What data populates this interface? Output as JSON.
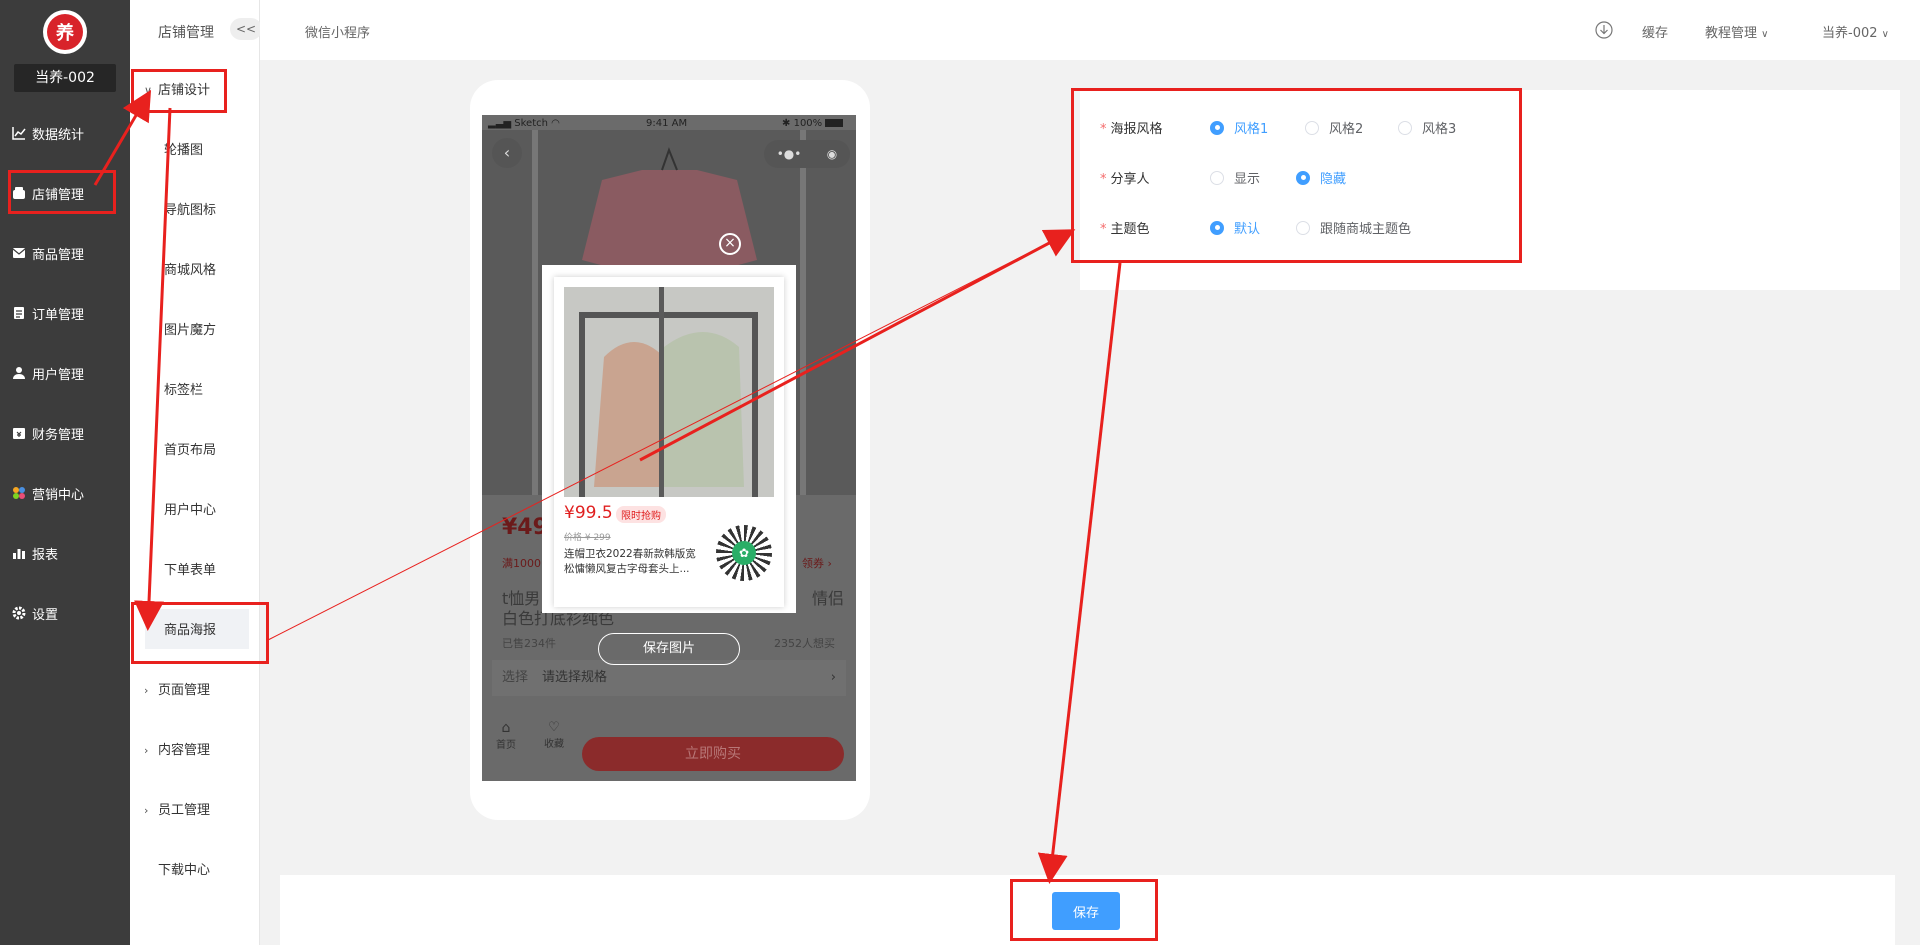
{
  "sidebar": {
    "store_name": "当养-002",
    "items": [
      {
        "label": "数据统计",
        "icon": "chart-line-icon"
      },
      {
        "label": "店铺管理",
        "icon": "store-icon"
      },
      {
        "label": "商品管理",
        "icon": "envelope-icon"
      },
      {
        "label": "订单管理",
        "icon": "clipboard-icon"
      },
      {
        "label": "用户管理",
        "icon": "user-icon"
      },
      {
        "label": "财务管理",
        "icon": "finance-icon"
      },
      {
        "label": "营销中心",
        "icon": "marketing-icon"
      },
      {
        "label": "报表",
        "icon": "bar-chart-icon"
      },
      {
        "label": "设置",
        "icon": "gear-icon"
      }
    ]
  },
  "submenu": {
    "title": "店铺管理",
    "collapse_label": "<<",
    "group_design": "店铺设计",
    "items": [
      "轮播图",
      "导航图标",
      "商城风格",
      "图片魔方",
      "标签栏",
      "首页布局",
      "用户中心",
      "下单表单",
      "商品海报"
    ],
    "group_page": "页面管理",
    "group_content": "内容管理",
    "group_staff": "员工管理",
    "download": "下载中心"
  },
  "topbar": {
    "breadcrumb": "微信小程序",
    "cache": "缓存",
    "tutorial": "教程管理",
    "user": "当养-002"
  },
  "phone": {
    "carrier": "Sketch",
    "time": "9:41 AM",
    "battery": "100%",
    "price_partial": "¥49",
    "coupon_partial": "满1000",
    "get_coupon": "领券",
    "title_left": "t恤男",
    "title_right": "情侣",
    "title_line2": "白色打底衫纯色",
    "sold": "已售234件",
    "wants": "2352人想买",
    "select_label": "选择",
    "select_value": "请选择规格",
    "nav_home": "首页",
    "nav_fav": "收藏",
    "buy_now": "立即购买",
    "poster": {
      "price": "¥99.5",
      "tag": "限时抢购",
      "original": "价格 ¥ 299",
      "desc": "连帽卫衣2022春新款韩版宽松慵懒风复古字母套头上..."
    },
    "save_image": "保存图片"
  },
  "settings": {
    "rows": [
      {
        "label": "海报风格",
        "options": [
          "风格1",
          "风格2",
          "风格3"
        ],
        "selected": 0
      },
      {
        "label": "分享人",
        "options": [
          "显示",
          "隐藏"
        ],
        "selected": 1
      },
      {
        "label": "主题色",
        "options": [
          "默认",
          "跟随商城主题色"
        ],
        "selected": 0
      }
    ]
  },
  "save_button": "保存",
  "colors": {
    "accent": "#409eff",
    "annotation": "#e8211e",
    "sidebar": "#3c3c3c",
    "buy": "#d8232a"
  }
}
